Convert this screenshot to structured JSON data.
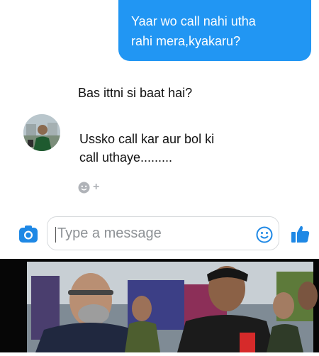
{
  "conversation": {
    "sent_message": {
      "lines": [
        "Yaar wo call nahi utha",
        "rahi mera,kyakaru?"
      ]
    },
    "received_messages": [
      {
        "lines": [
          "Bas ittni si baat hai?"
        ]
      },
      {
        "lines": [
          "Ussko call kar aur bol ki",
          "call uthaye........."
        ]
      }
    ],
    "reaction_add_symbol": "+"
  },
  "composer": {
    "placeholder": "Type a message",
    "camera_icon": "camera-icon",
    "emoji_icon": "smiley-icon",
    "like_icon": "thumbs-up-icon"
  },
  "colors": {
    "accent": "#2196f3",
    "bubble_text": "#ffffff"
  }
}
